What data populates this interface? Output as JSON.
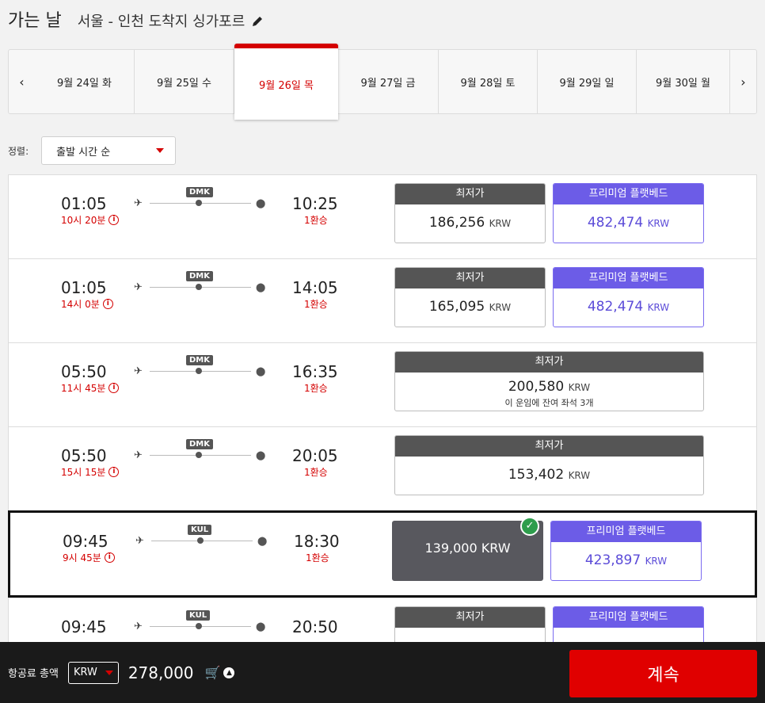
{
  "header": {
    "title": "가는 날",
    "route": "서울 - 인천 도착지 싱가포르"
  },
  "dates": [
    "9월 24일 화",
    "9월 25일 수",
    "9월 26일 목",
    "9월 27일 금",
    "9월 28일 토",
    "9월 29일 일",
    "9월 30일 월"
  ],
  "selected_date_index": 2,
  "sort": {
    "label": "정렬:",
    "value": "출발 시간 순"
  },
  "fare_labels": {
    "lowest": "최저가",
    "premium": "프리미엄 플랫베드",
    "currency": "KRW"
  },
  "flights": [
    {
      "dep": "01:05",
      "duration": "10시 20분",
      "stop": "DMK",
      "arr": "10:25",
      "stops": "1환승",
      "lowest": "186,256",
      "premium": "482,474"
    },
    {
      "dep": "01:05",
      "duration": "14시 0분",
      "stop": "DMK",
      "arr": "14:05",
      "stops": "1환승",
      "lowest": "165,095",
      "premium": "482,474"
    },
    {
      "dep": "05:50",
      "duration": "11시 45분",
      "stop": "DMK",
      "arr": "16:35",
      "stops": "1환승",
      "lowest": "200,580",
      "seats": "이 운임에 잔여 좌석 3개"
    },
    {
      "dep": "05:50",
      "duration": "15시 15분",
      "stop": "DMK",
      "arr": "20:05",
      "stops": "1환승",
      "lowest": "153,402"
    },
    {
      "dep": "09:45",
      "duration": "9시 45분",
      "stop": "KUL",
      "arr": "18:30",
      "stops": "1환승",
      "chosen": "139,000 KRW",
      "premium": "423,897"
    },
    {
      "dep": "09:45",
      "stop": "KUL",
      "arr": "20:50"
    }
  ],
  "footer": {
    "total_label": "항공료 총액",
    "currency": "KRW",
    "total": "278,000",
    "continue": "계속"
  },
  "colors": {
    "accent": "#d40000",
    "premium": "#6c5ce7",
    "fare_head": "#555555",
    "check": "#2e9d4c"
  }
}
